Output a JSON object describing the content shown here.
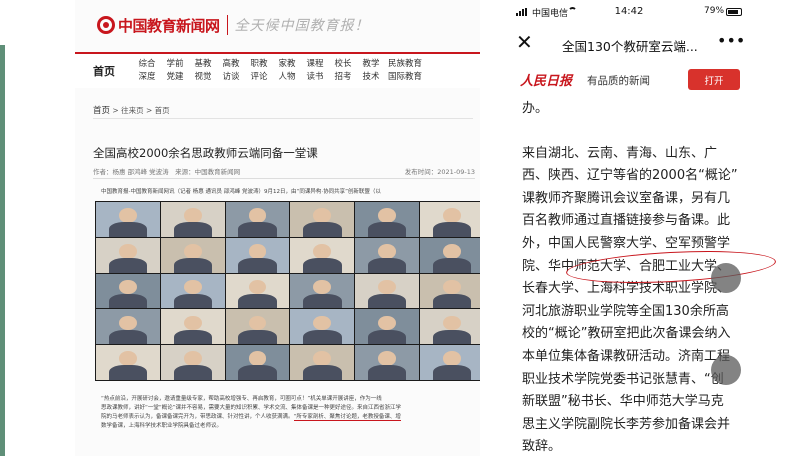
{
  "left": {
    "site": {
      "logo_text": "中国教育新闻网",
      "slogan": "全天候中国教育报！"
    },
    "nav": {
      "home": "首页",
      "columns": [
        [
          "综合",
          "深度"
        ],
        [
          "学前",
          "党建"
        ],
        [
          "基教",
          "视觉"
        ],
        [
          "高教",
          "访谈"
        ],
        [
          "职教",
          "评论"
        ],
        [
          "家教",
          "人物"
        ],
        [
          "课程",
          "读书"
        ],
        [
          "校长",
          "招考"
        ],
        [
          "教学",
          "技术"
        ],
        [
          "民族教育",
          "国际教育"
        ]
      ]
    },
    "breadcrumb": {
      "home": "首页",
      "path": "> 往来页 > 首页"
    },
    "article": {
      "title": "全国高校2000余名思政教师云端同备一堂课",
      "meta_left": "作者：杨惠 邵鸿峰 党波涛　来源：中国教育新闻网",
      "meta_right": "发布时间：2021-09-13",
      "lead": "中国教育报-中国教育新闻网讯（记者 杨惠 通讯员 邵鸿峰 党波涛）9月12日，由“同课异构·协同共享”创新联盟（以",
      "caption_lines": [
        "“热点前沿，开展研讨会，邀请重量级专家，帮助高校增强专、再启教育，可圈可点！”机关单课开展讲座，作为一线",
        "思政课教师，讲好“一堂“概论”课并不容易，需要大量的知识积累、学术交流、集体备课是一种更好途径。来自江西省浙江学",
        "院的马老师表示认为，备课备课完开为，带思政课、针对性讲，个人收获满满。",
        "数学备课，上海科学技术职业学院具备过老师议。"
      ],
      "underlined": "“所专家剖析、聚焦讨论题，老教授备课、增"
    }
  },
  "phone": {
    "status": {
      "carrier": "中国电信",
      "time": "14:42",
      "battery": "79%"
    },
    "appbar": {
      "title": "全国130个教研室云端..."
    },
    "banner": {
      "logo": "人民日报",
      "slogan": "有品质的新闻",
      "open": "打开"
    },
    "article": {
      "para1": "办。",
      "lines": [
        "来自湖北、云南、青海、山东、广",
        "西、陕西、辽宁等省的2000名“概论”",
        "课教师齐聚腾讯会议室备课，另有几",
        "百名教师通过直播链接参与备课。此",
        "外，中国人民警察大学、空军预警学",
        "院、华中师范大学、合肥工业大学、",
        "长春大学、上海科学技术职业学院、",
        "河北旅游职业学院等全国130余所高",
        "校的“概论”教研室把此次备课会纳入",
        "本单位集体备课教研活动。济南工程",
        "职业技术学院党委书记张慧青、“创",
        "新联盟”秘书长、华中师范大学马克",
        "思主义学院副院长李芳参加备课会并",
        "致辞。"
      ]
    }
  }
}
